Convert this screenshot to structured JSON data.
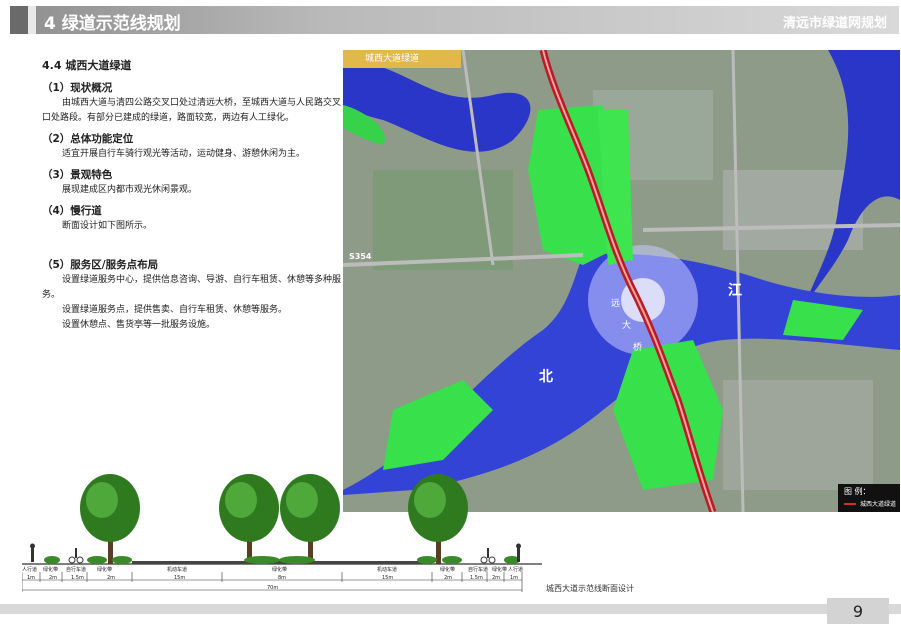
{
  "header": {
    "title": "4  绿道示范线规划",
    "right": "清远市绿道网规划"
  },
  "text": {
    "section_title": "4.4 城西大道绿道",
    "s1": {
      "heading": "（1）现状概况",
      "body": "由城西大道与清四公路交叉口处过清远大桥，至城西大道与人民路交叉口处路段。有部分已建成的绿道，路面较宽，两边有人工绿化。"
    },
    "s2": {
      "heading": "（2）总体功能定位",
      "body": "适宜开展自行车骑行观光等活动，运动健身、游憩休闲为主。"
    },
    "s3": {
      "heading": "（3）景观特色",
      "body": "展现建成区内都市观光休闲景观。"
    },
    "s4": {
      "heading": "（4）慢行道",
      "body": "断面设计如下图所示。"
    },
    "s5": {
      "heading": "（5）服务区/服务点布局",
      "b1": "设置绿道服务中心，提供信息咨询、导游、自行车租赁、休憩等多种服务。",
      "b2": "设置绿道服务点，提供售卖、自行车租赁、休憩等服务。",
      "b3": "设置休憩点、售货亭等一批服务设施。"
    }
  },
  "map": {
    "label": "城西大道绿道",
    "road_label": "S354",
    "river_1": "北",
    "river_2": "江",
    "bridge": [
      "远",
      "大",
      "桥"
    ],
    "legend_title": "图    例：",
    "legend_item": "城西大道绿道"
  },
  "section": {
    "labels": [
      "人行道",
      "绿化带",
      "自行车道",
      "绿化带",
      "机动车道",
      "绿化带",
      "机动车道",
      "绿化带",
      "自行车道",
      "绿化带",
      "人行道"
    ],
    "dims": [
      "1m",
      "2m",
      "1.5m",
      "2m",
      "15m",
      "8m",
      "15m",
      "2m",
      "1.5m",
      "2m",
      "1m"
    ],
    "total": "70m",
    "caption": "城西大道示范线断面设计"
  },
  "page": "9",
  "colors": {
    "header_dark": "#6a6a6a",
    "river": "#2233cc",
    "green": "#33dd44",
    "road": "#cc1f2a"
  }
}
